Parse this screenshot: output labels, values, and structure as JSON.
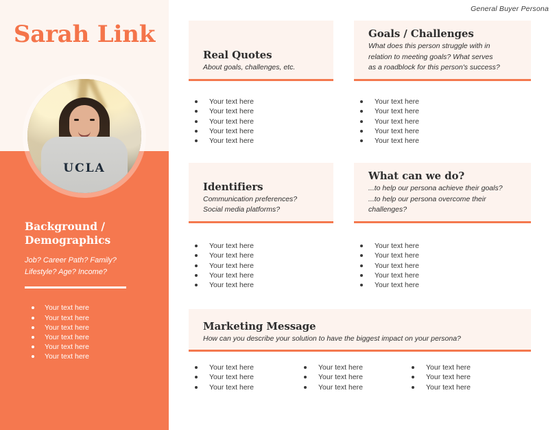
{
  "document_label": "General Buyer Persona",
  "sidebar": {
    "persona_name": "Sarah Link",
    "avatar_alt": "persona-photo",
    "avatar_sweatshirt_text": "UCLA",
    "background_heading": "Background /\nDemographics",
    "background_subtitle": "Job? Career Path? Family?\nLifestyle? Age? Income?",
    "bullets": [
      "Your text here",
      "Your text here",
      "Your text here",
      "Your text here",
      "Your text here",
      "Your text here"
    ]
  },
  "cards": {
    "real_quotes": {
      "title": "Real Quotes",
      "subtitle": "About goals, challenges, etc.",
      "bullets": [
        "Your text here",
        "Your text here",
        "Your text here",
        "Your text here",
        "Your text here"
      ]
    },
    "goals_challenges": {
      "title": "Goals / Challenges",
      "subtitle": "What does this person struggle with in\nrelation to meeting goals? What serves\nas a roadblock for this person's success?",
      "bullets": [
        "Your text here",
        "Your text here",
        "Your text here",
        "Your text here",
        "Your text here"
      ]
    },
    "identifiers": {
      "title": "Identifiers",
      "subtitle": "Communication preferences?\nSocial media platforms?",
      "bullets": [
        "Your text here",
        "Your text here",
        "Your text here",
        "Your text here",
        "Your text here"
      ]
    },
    "what_can_we_do": {
      "title": "What can we do?",
      "subtitle": "...to help our persona achieve their goals?\n...to help our persona overcome their\nchallenges?",
      "bullets": [
        "Your text here",
        "Your text here",
        "Your text here",
        "Your text here",
        "Your text here"
      ]
    },
    "marketing_message": {
      "title": "Marketing Message",
      "subtitle": "How can you describe your solution to have the biggest impact on your persona?",
      "bullets_col1": [
        "Your text here",
        "Your text here",
        "Your text here"
      ],
      "bullets_col2": [
        "Your text here",
        "Your text here",
        "Your text here"
      ],
      "bullets_col3": [
        "Your text here",
        "Your text here",
        "Your text here"
      ]
    }
  },
  "colors": {
    "accent_orange": "#f5784f",
    "card_background": "#fdf3ee",
    "sidebar_top_background": "#fdf5f0",
    "page_background": "#ffffff",
    "text_dark": "#2f2f2f",
    "text_white": "#ffffff"
  }
}
